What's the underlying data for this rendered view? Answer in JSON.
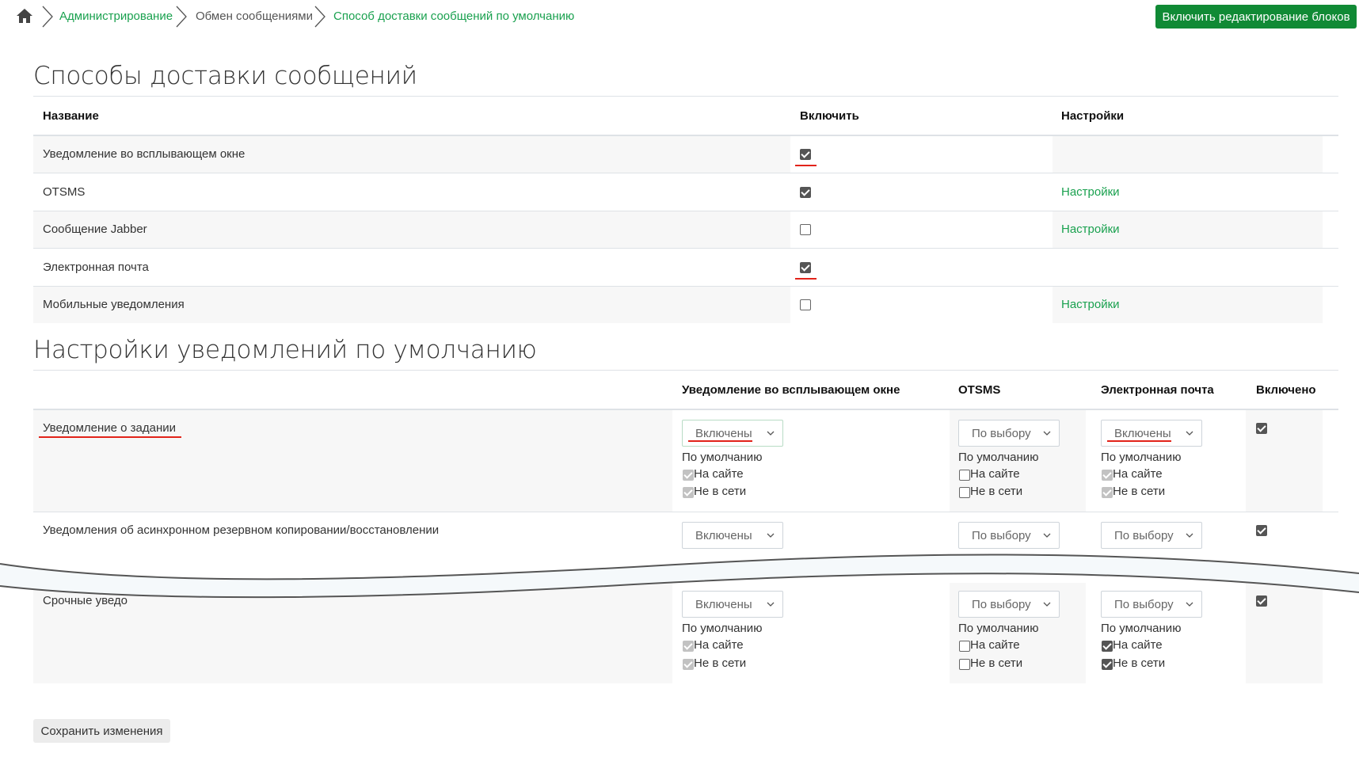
{
  "breadcrumb": {
    "items": [
      "Администрирование",
      "Обмен сообщениями",
      "Способ доставки сообщений по умолчанию"
    ]
  },
  "header": {
    "edit_button": "Включить редактирование блоков"
  },
  "section1": {
    "title": "Способы доставки сообщений",
    "columns": [
      "Название",
      "Включить",
      "Настройки"
    ],
    "rows": [
      {
        "name": "Уведомление во всплывающем окне",
        "enabled": true,
        "settings": ""
      },
      {
        "name": "OTSMS",
        "enabled": true,
        "settings": "Настройки"
      },
      {
        "name": "Сообщение Jabber",
        "enabled": false,
        "settings": "Настройки"
      },
      {
        "name": "Электронная почта",
        "enabled": true,
        "settings": ""
      },
      {
        "name": "Мобильные уведомления",
        "enabled": false,
        "settings": "Настройки"
      }
    ]
  },
  "section2": {
    "title": "Настройки уведомлений по умолчанию",
    "columns": [
      "Уведомление во всплывающем окне",
      "OTSMS",
      "Электронная почта",
      "Включено"
    ],
    "default_label": "По умолчанию",
    "on_site_label": "На сайте",
    "offline_label": "Не в сети",
    "rows": [
      {
        "name": "Уведомление о задании",
        "popup": {
          "select": "Включены",
          "on_site": true,
          "offline": true
        },
        "otsms": {
          "select": "По выбору",
          "on_site": false,
          "offline": false
        },
        "email": {
          "select": "Включены",
          "on_site": true,
          "offline": true
        },
        "enabled": true
      },
      {
        "name": "Уведомления об асинхронном резервном копировании/восстановлении",
        "popup": {
          "select": "Включены"
        },
        "otsms": {
          "select": "По выбору"
        },
        "email": {
          "select": "По выбору"
        },
        "enabled": true
      },
      {
        "name": "Срочные уведо",
        "popup": {
          "select": "Включены",
          "on_site": true,
          "offline": true
        },
        "otsms": {
          "select": "По выбору",
          "on_site": false,
          "offline": false
        },
        "email": {
          "select": "По выбору",
          "on_site": true,
          "offline": true
        },
        "enabled": true
      }
    ]
  },
  "footer": {
    "save_button": "Сохранить изменения"
  },
  "colors": {
    "accent_green": "#1aa14f",
    "button_green": "#108a35",
    "annotation_red": "#e2231a"
  }
}
